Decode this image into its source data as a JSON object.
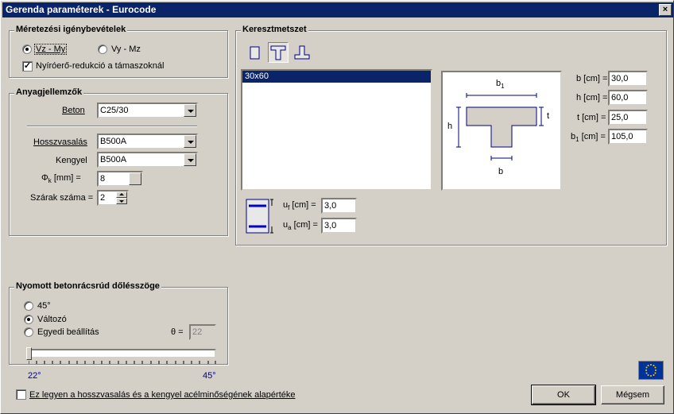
{
  "window": {
    "title": "Gerenda paraméterek - Eurocode",
    "close_glyph": "×"
  },
  "loads": {
    "title": "Méretezési igénybevételek",
    "option1": "Vz - My",
    "option2": "Vy - Mz",
    "selected": "Vz - My",
    "checkbox_label": "Nyíróerő-redukció a támaszoknál",
    "checkbox_checked": true
  },
  "materials": {
    "title": "Anyagjellemzők",
    "beton_label": "Beton",
    "beton_value": "C25/30",
    "long_label": "Hosszvasalás",
    "long_value": "B500A",
    "stirrup_label": "Kengyel",
    "stirrup_value": "B500A",
    "phi_label": "Φ",
    "phi_sub": "k",
    "phi_unit": "[mm] =",
    "phi_value": "8",
    "legs_label": "Szárak száma =",
    "legs_value": "2"
  },
  "cross_section": {
    "title": "Keresztmetszet",
    "list_items": [
      "30x60"
    ],
    "selected_item": "30x60",
    "shapes": [
      "rectangle-icon",
      "t-section-icon",
      "inverted-t-icon"
    ],
    "selected_shape": "t-section-icon",
    "diagram_labels": {
      "b1": "b",
      "b1_sub": "1",
      "h": "h",
      "t": "t",
      "b": "b"
    },
    "params": [
      {
        "label": "b [cm] =",
        "value": "30,0"
      },
      {
        "label": "h [cm] =",
        "value": "60,0"
      },
      {
        "label": "t [cm] =",
        "value": "25,0"
      },
      {
        "label": "b",
        "sub": "1",
        "suffix": " [cm] =",
        "value": "105,0"
      }
    ],
    "cover": [
      {
        "label": "u",
        "sub": "f",
        "suffix": " [cm] =",
        "value": "3,0"
      },
      {
        "label": "u",
        "sub": "a",
        "suffix": " [cm] =",
        "value": "3,0"
      }
    ]
  },
  "angle": {
    "title": "Nyomott betonrácsrúd dőlésszöge",
    "option1": "45°",
    "option2": "Változó",
    "option3": "Egyedi beállítás",
    "selected": "Változó",
    "theta_label": "θ =",
    "theta_value": "22",
    "slider_min": "22°",
    "slider_max": "45°",
    "slider_value": 22
  },
  "footer": {
    "default_checkbox_label": "Ez legyen a hosszvasalás és a kengyel acélminőségének alapértéke",
    "default_checkbox_checked": false,
    "ok_label": "OK",
    "cancel_label": "Mégsem"
  },
  "colors": {
    "titlebar": "#0a246a",
    "selection": "#0a246a",
    "eu_flag": "#003399",
    "eu_stars": "#ffcc00"
  }
}
